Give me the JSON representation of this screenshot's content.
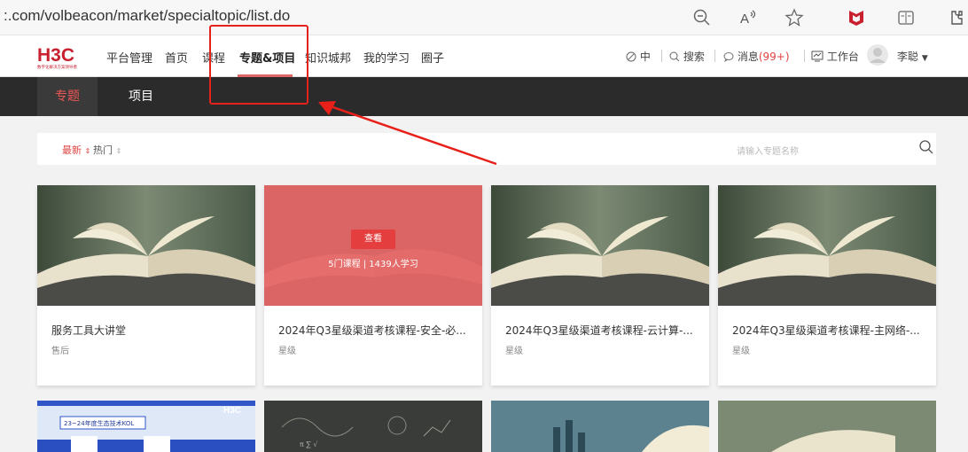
{
  "browser": {
    "url": ":.com/volbeacon/market/specialtopic/list.do",
    "icons": [
      "zoom-out-icon",
      "read-aloud-icon",
      "favorite-star-icon",
      "mcafee-icon",
      "immersive-reader-icon",
      "extensions-icon"
    ]
  },
  "header": {
    "logo_text": "H3C",
    "logo_subtext": "数字化解决方案领导者",
    "nav": [
      "平台管理",
      "首页",
      "课程",
      "专题&项目",
      "知识城邦",
      "我的学习",
      "圈子"
    ],
    "active_nav": "专题&项目",
    "lang": "中",
    "search_label": "搜索",
    "messages_label": "消息",
    "messages_count": "(99+)",
    "workbench_label": "工作台",
    "user_name": "李聪",
    "colors": {
      "accent": "#e06666",
      "red": "#e04343"
    }
  },
  "subnav": {
    "tabs": [
      "专题",
      "项目"
    ],
    "active": "专题"
  },
  "filter": {
    "sort_newest": "最新",
    "sort_hot": "热门",
    "search_placeholder": "请输入专题名称"
  },
  "cards": [
    {
      "title": "服务工具大讲堂",
      "tag": "售后"
    },
    {
      "title": "2024年Q3星级渠道考核课程-安全-必...",
      "tag": "星级",
      "hover_button": "查看",
      "meta": "5门课程 | 1439人学习"
    },
    {
      "title": "2024年Q3星级渠道考核课程-云计算-...",
      "tag": "星级"
    },
    {
      "title": "2024年Q3星级渠道考核课程-主网络-...",
      "tag": "星级"
    }
  ],
  "second_row": {
    "card1_logo": "H3C",
    "card1_banner": "23~24年度生态技术KOL"
  }
}
